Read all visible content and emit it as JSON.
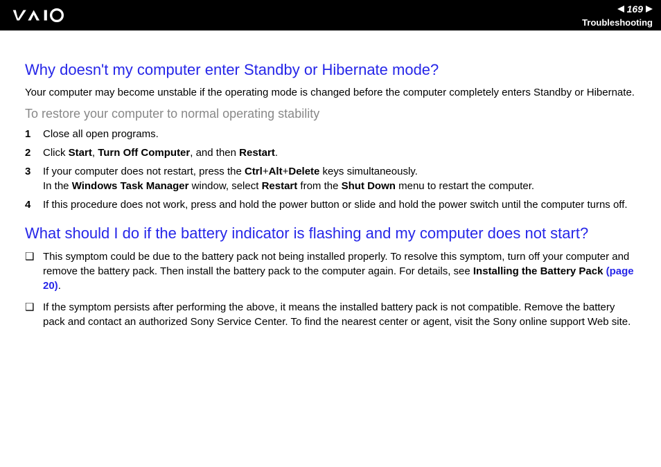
{
  "header": {
    "page_number": "169",
    "section": "Troubleshooting"
  },
  "q1": {
    "heading": "Why doesn't my computer enter Standby or Hibernate mode?",
    "intro": "Your computer may become unstable if the operating mode is changed before the computer completely enters Standby or Hibernate.",
    "subhead": "To restore your computer to normal operating stability",
    "steps": {
      "s1": {
        "n": "1",
        "text": "Close all open programs."
      },
      "s2": {
        "n": "2",
        "pre": "Click ",
        "b1": "Start",
        "mid1": ", ",
        "b2": "Turn Off Computer",
        "mid2": ", and then ",
        "b3": "Restart",
        "post": "."
      },
      "s3": {
        "n": "3",
        "line1_pre": "If your computer does not restart, press the ",
        "b1": "Ctrl",
        "plus1": "+",
        "b2": "Alt",
        "plus2": "+",
        "b3": "Delete",
        "line1_post": " keys simultaneously.",
        "line2_pre": "In the ",
        "b4": "Windows Task Manager",
        "line2_mid1": " window, select ",
        "b5": "Restart",
        "line2_mid2": " from the ",
        "b6": "Shut Down",
        "line2_post": " menu to restart the computer."
      },
      "s4": {
        "n": "4",
        "text": "If this procedure does not work, press and hold the power button or slide and hold the power switch until the computer turns off."
      }
    }
  },
  "q2": {
    "heading": "What should I do if the battery indicator is flashing and my computer does not start?",
    "items": {
      "i1": {
        "pre": "This symptom could be due to the battery pack not being installed properly. To resolve this symptom, turn off your computer and remove the battery pack. Then install the battery pack to the computer again. For details, see ",
        "b1": "Installing the Battery Pack ",
        "link": "(page 20)",
        "post": "."
      },
      "i2": {
        "text": "If the symptom persists after performing the above, it means the installed battery pack is not compatible. Remove the battery pack and contact an authorized Sony Service Center. To find the nearest center or agent, visit the Sony online support Web site."
      }
    }
  },
  "bullet_glyph": "❑"
}
